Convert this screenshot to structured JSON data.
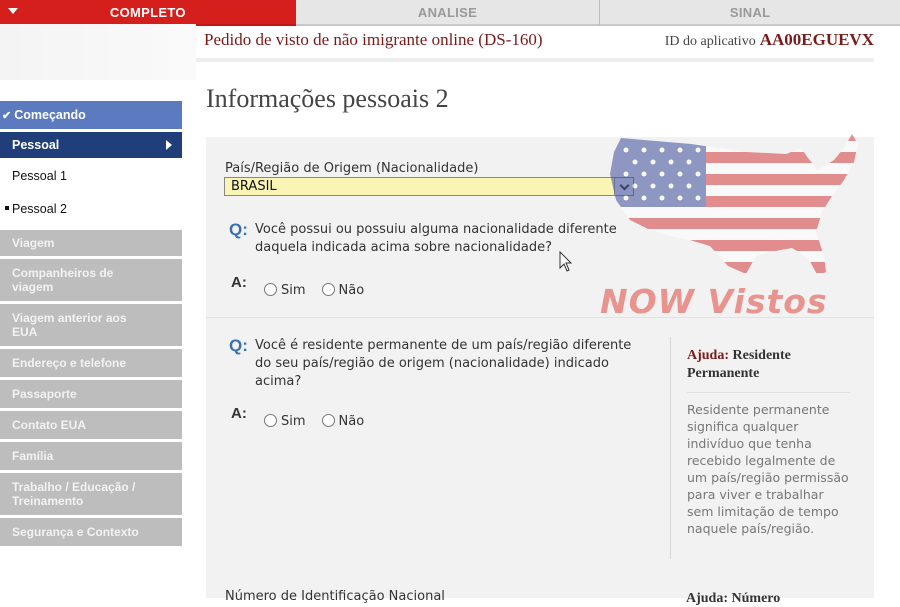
{
  "tabs": {
    "complete": "COMPLETO",
    "review": "ANALISE",
    "sign": "SINAL"
  },
  "header": {
    "form_title": "Pedido de visto de não imigrante online (DS-160)",
    "app_id_label": "ID do aplicativo",
    "app_id_value": "AA00EGUEVX"
  },
  "sidebar": {
    "start": "Começando",
    "personal": "Pessoal",
    "personal_1": "Pessoal 1",
    "personal_2": "Pessoal 2",
    "disabled": [
      "Viagem",
      "Companheiros de viagem",
      "Viagem anterior aos EUA",
      "Endereço e telefone",
      "Passaporte",
      "Contato EUA",
      "Família",
      "Trabalho / Educação / Treinamento",
      "Segurança e Contexto"
    ]
  },
  "main": {
    "page_title": "Informações pessoais 2",
    "nationality_label": "País/Região de Origem (Nacionalidade)",
    "nationality_value": "BRASIL",
    "q_mark": "Q:",
    "a_mark": "A:",
    "question1": "Você possui ou possuiu alguma nacionalidade diferente daquela indicada acima sobre nacionalidade?",
    "question2": "Você é residente permanente de um país/região diferente do seu país/região de origem (nacionalidade) indicado acima?",
    "yes": "Sim",
    "no": "Não",
    "bottom_label": "Número de Identificação Nacional"
  },
  "help": {
    "label": "Ajuda:",
    "title": "Residente Permanente",
    "text": "Residente permanente significa qualquer indivíduo que tenha recebido legalmente de um país/região permissão para viver e trabalhar sem limitação de tempo naquele país/região.",
    "bottom_title": "Ajuda: Número"
  },
  "watermark": {
    "text": "NOW Vistos"
  },
  "colors": {
    "complete_red": "#d51f1c",
    "nav_active": "#1f3e7a",
    "nav_start": "#5b7ac0",
    "select_bg": "#fbf5b5",
    "q_blue": "#3a6fb0",
    "title_maroon": "#7a1a1a"
  }
}
